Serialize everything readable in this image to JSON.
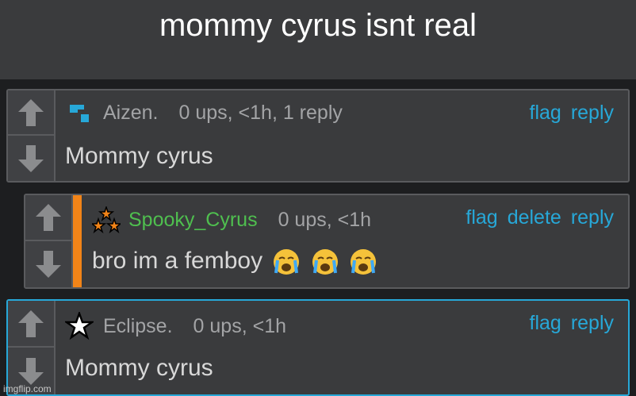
{
  "caption": "mommy cyrus isnt real",
  "comments": [
    {
      "username": "Aizen.",
      "meta": "0 ups, <1h, 1 reply",
      "body": "Mommy cyrus",
      "actions": {
        "flag": "flag",
        "reply": "reply"
      }
    },
    {
      "username": "Spooky_Cyrus",
      "meta": "0 ups, <1h",
      "body": "bro im a femboy",
      "actions": {
        "flag": "flag",
        "delete": "delete",
        "reply": "reply"
      }
    },
    {
      "username": "Eclipse.",
      "meta": "0 ups, <1h",
      "body": "Mommy cyrus",
      "actions": {
        "flag": "flag",
        "reply": "reply"
      }
    }
  ],
  "icons": [
    "upvote-arrow-icon",
    "downvote-arrow-icon",
    "blue-square-badge-icon",
    "orange-stars-badge-icon",
    "white-star-badge-icon",
    "crying-face-emoji"
  ],
  "colors": {
    "link": "#27a8d8",
    "reply_stripe": "#f28418",
    "highlight_border": "#27a8d8",
    "username_green": "#4fbf4f"
  },
  "watermark": "imgflip.com"
}
